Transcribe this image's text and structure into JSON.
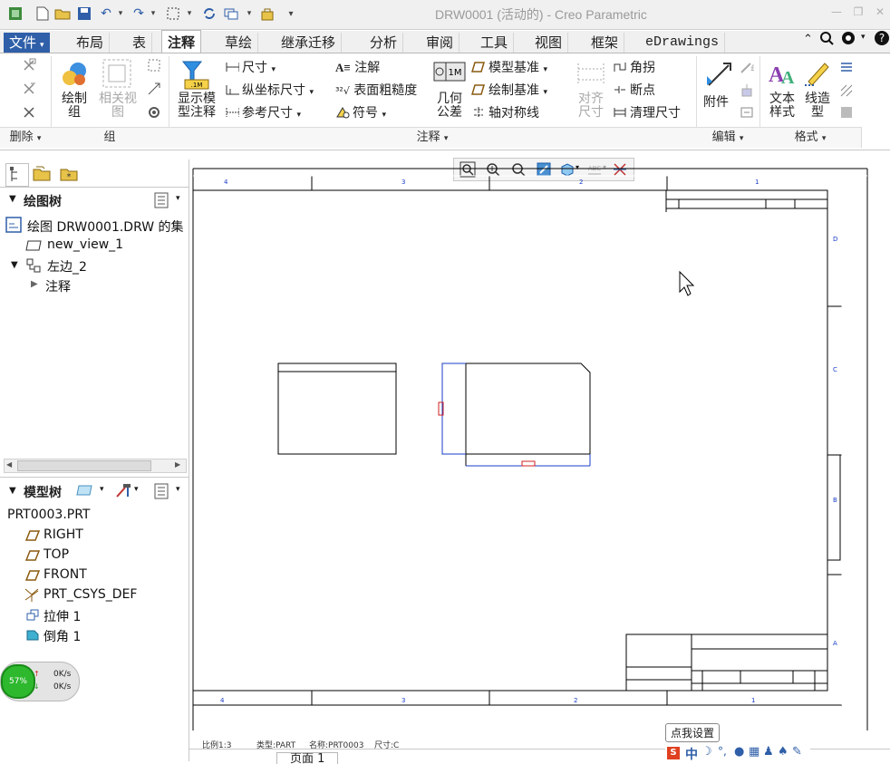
{
  "window": {
    "title": "DRW0001 (活动的) - Creo Parametric"
  },
  "menu_tabs": [
    {
      "label": "文件",
      "has_dropdown": true
    },
    {
      "label": "布局"
    },
    {
      "label": "表"
    },
    {
      "label": "注释",
      "active": true
    },
    {
      "label": "草绘"
    },
    {
      "label": "继承迁移"
    },
    {
      "label": "分析"
    },
    {
      "label": "审阅"
    },
    {
      "label": "工具"
    },
    {
      "label": "视图"
    },
    {
      "label": "框架"
    },
    {
      "label": "eDrawings"
    }
  ],
  "ribbon": {
    "group_labels": {
      "delete": "删除",
      "group": "组",
      "annotate": "注释",
      "edit": "编辑",
      "format": "格式"
    },
    "buttons": {
      "draw_group": "绘制组",
      "draw_group_2": "",
      "related_view": "相关视图",
      "show_model_annotation": "显示模型注释",
      "dimension": "尺寸",
      "ordinate_dimension": "纵坐标尺寸",
      "reference_dimension": "参考尺寸",
      "note": "注解",
      "surface_finish": "表面粗糙度",
      "symbol": "符号",
      "geometric_tolerance": "几何公差",
      "model_datum": "模型基准",
      "draw_datum": "绘制基准",
      "axis_symmetric_line": "轴对称线",
      "align_dimension": "对齐尺寸",
      "jog": "角拐",
      "breakpoint": "断点",
      "clean_dimension": "清理尺寸",
      "attachment": "附件",
      "text_style": "文本样式",
      "line_style": "线造型"
    }
  },
  "left_panel": {
    "drawing_tree_title": "绘图树",
    "drawing_tree_items": [
      {
        "label": "绘图 DRW0001.DRW 的集"
      },
      {
        "label": "new_view_1"
      },
      {
        "label": "左边_2"
      },
      {
        "label": "注释"
      }
    ],
    "model_tree_title": "模型树",
    "model_tree_items": [
      {
        "label": "PRT0003.PRT"
      },
      {
        "label": "RIGHT"
      },
      {
        "label": "TOP"
      },
      {
        "label": "FRONT"
      },
      {
        "label": "PRT_CSYS_DEF"
      },
      {
        "label": "拉伸 1"
      },
      {
        "label": "倒角 1"
      }
    ]
  },
  "net_widget": {
    "percent": "57%",
    "up_rate": "0K/s",
    "down_rate": "0K/s"
  },
  "sheet": {
    "top_zone_labels": [
      "4",
      "3",
      "2",
      "1"
    ],
    "bottom_zone_labels": [
      "4",
      "3",
      "2",
      "1"
    ],
    "right_zone_labels": [
      "D",
      "C",
      "B",
      "A"
    ]
  },
  "status_bar": {
    "scale": "比例1:3",
    "type": "类型:PART",
    "name": "名称:PRT0003",
    "size": "尺寸:C",
    "page_tab": "页面 1"
  },
  "ime": {
    "tooltip": "点我设置",
    "mode_label": "中"
  },
  "colors": {
    "accent_blue": "#2f5fa8",
    "view_blue": "#1a3cc8",
    "marker_red": "#d02020"
  }
}
